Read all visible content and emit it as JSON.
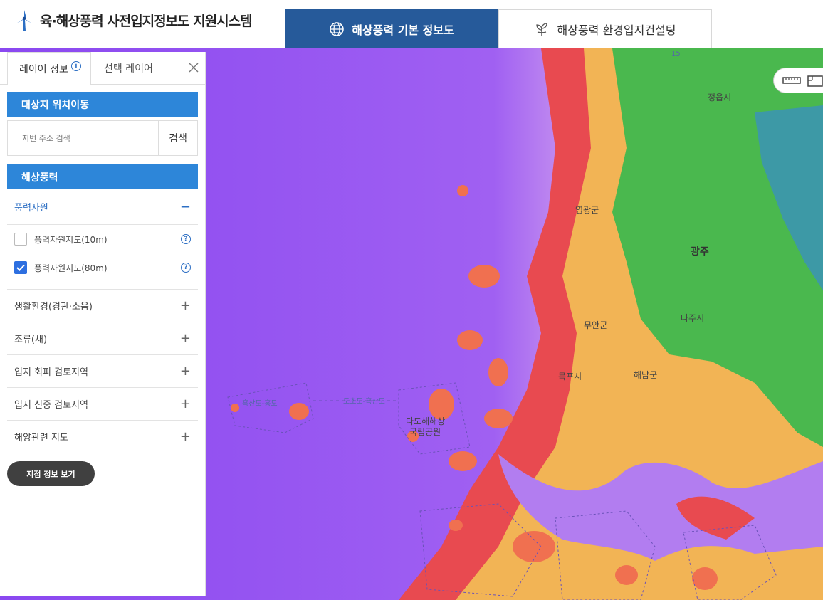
{
  "header": {
    "app_title": "육·해상풍력 사전입지정보도 지원시스템",
    "tabs": [
      {
        "label": "해상풍력 기본 정보도",
        "icon": "globe-icon",
        "active": true
      },
      {
        "label": "해상풍력 환경입지컨설팅",
        "icon": "sprout-icon",
        "active": false
      }
    ]
  },
  "panel": {
    "tabs": [
      {
        "label": "레이어 정보",
        "active": true
      },
      {
        "label": "선택 레이어",
        "active": false
      }
    ],
    "location_section": {
      "title": "대상지 위치이동",
      "search_placeholder": "지번 주소 검색",
      "search_button": "검색"
    },
    "offshore_section": {
      "title": "해상풍력",
      "open_group": {
        "label": "풍력자원",
        "layers": [
          {
            "label": "풍력자원지도(10m)",
            "checked": false
          },
          {
            "label": "풍력자원지도(80m)",
            "checked": true
          }
        ]
      },
      "groups": [
        {
          "label": "생활환경(경관·소음)"
        },
        {
          "label": "조류(새)"
        },
        {
          "label": "입지 회피 검토지역"
        },
        {
          "label": "입지 신중 검토지역"
        },
        {
          "label": "해양관련 지도"
        }
      ]
    },
    "point_button": "지점 정보 보기"
  },
  "map": {
    "labels": {
      "gwangju": "광주",
      "jeongeup": "정읍시",
      "naju": "나주시",
      "yeonggwang": "영광군",
      "muan": "무안군",
      "mokpo": "목포시",
      "haenam": "해남군",
      "dadohae": "다도해해상",
      "dadohae2": "국립공원",
      "heuksan": "흑산도-홍도",
      "route": "도초도-흑산도",
      "route15": "15"
    }
  },
  "colors": {
    "accent": "#265a9a",
    "section": "#2d86d9",
    "sea": "#9a50f0"
  }
}
